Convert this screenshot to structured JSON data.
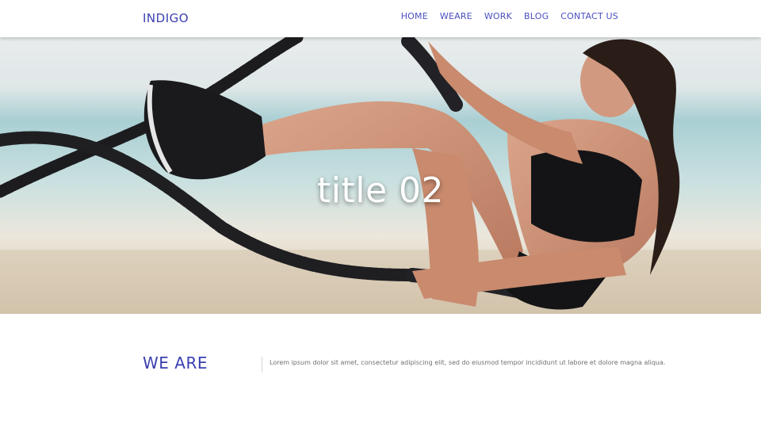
{
  "header": {
    "brand": "INDIGO",
    "nav": [
      {
        "label": "HOME"
      },
      {
        "label": "WEARE"
      },
      {
        "label": "WORK"
      },
      {
        "label": "BLOG"
      },
      {
        "label": "CONTACT US"
      }
    ]
  },
  "hero": {
    "title": "title 02"
  },
  "weare": {
    "title": "WE ARE",
    "text": "Lorem ipsum dolor sit amet, consectetur adipiscing elit, sed do eiusmod tempor incididunt ut labore et dolore magna aliqua."
  },
  "colors": {
    "brand": "#3a3fb0",
    "nav": "#4a4fc0",
    "body_text": "#707070"
  }
}
